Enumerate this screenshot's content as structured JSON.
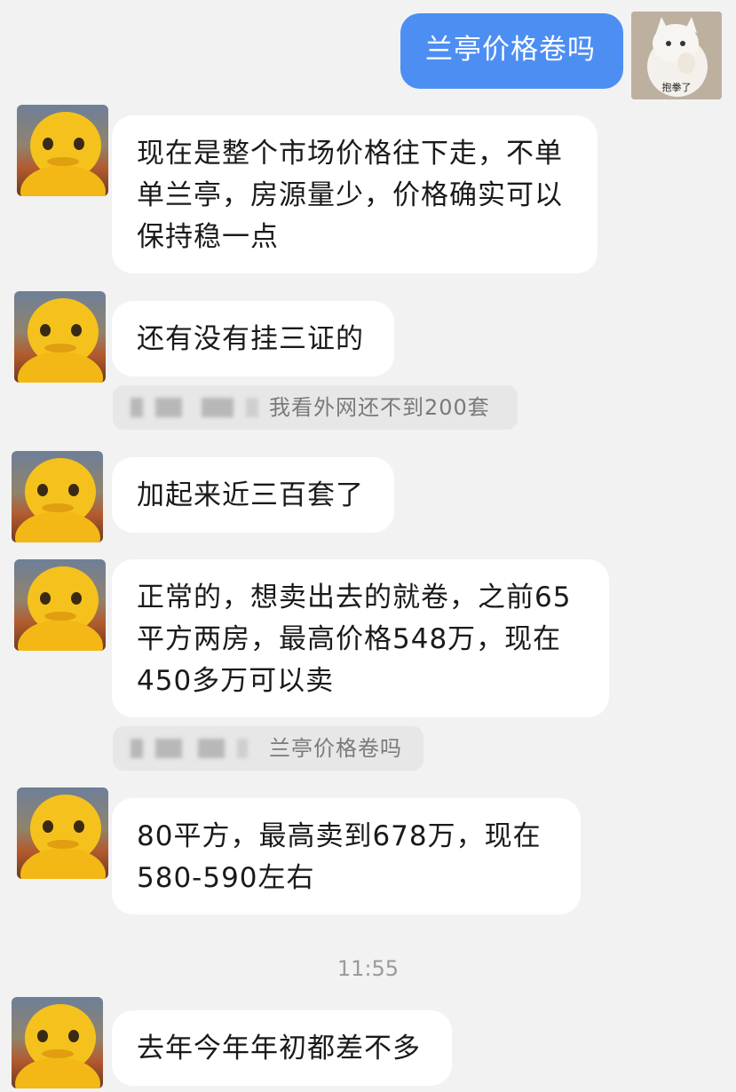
{
  "self_message": {
    "text": "兰亭价格卷吗",
    "sticker_caption": "抱拳了",
    "bubble_color": "#4d8ef3"
  },
  "messages": [
    {
      "text": "现在是整个市场价格往下走，不单单兰亭，房源量少，价格确实可以保持稳一点"
    },
    {
      "text": "还有没有挂三证的"
    },
    {
      "text": "加起来近三百套了"
    },
    {
      "text": "正常的，想卖出去的就卷，之前65平方两房，最高价格548万，现在450多万可以卖"
    },
    {
      "text": "80平方，最高卖到678万，现在580-590左右"
    },
    {
      "text": "去年今年年初都差不多"
    }
  ],
  "quotes": [
    {
      "text": "我看外网还不到200套"
    },
    {
      "text": "兰亭价格卷吗"
    }
  ],
  "timestamp": "11:55",
  "avatar_icon": "yellow-cartoon-character-avatar"
}
